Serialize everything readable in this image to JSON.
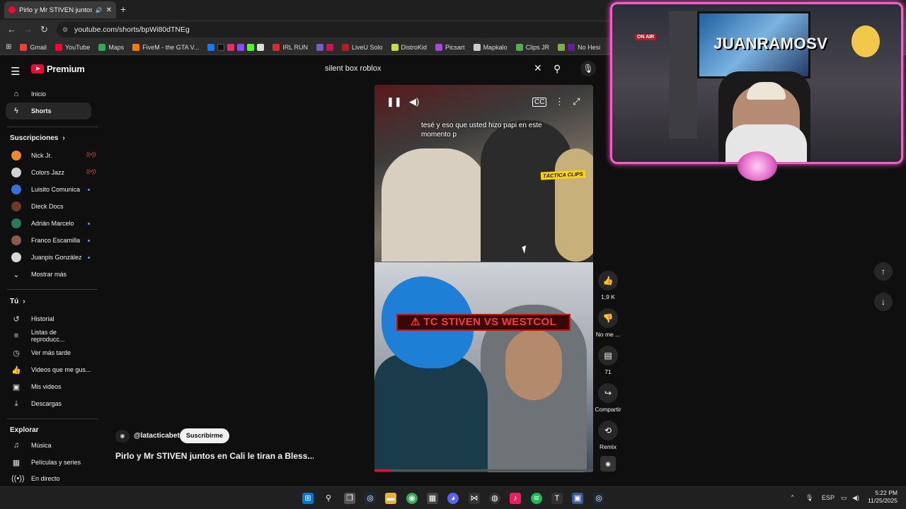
{
  "browser": {
    "tab_title": "Pirlo y Mr STIVEN juntos en",
    "new_tab": "+",
    "url": "youtube.com/shorts/bpWi80dTNEg",
    "bookmarks": [
      "Gmail",
      "YouTube",
      "Maps",
      "FiveM - the GTA V...",
      "IRL RUN",
      "LiveU Solo",
      "DistroKid",
      "Picsart",
      "Mapkalo",
      "Clips JR",
      "No Hesi"
    ]
  },
  "header": {
    "logo": "Premium",
    "search_value": "silent box roblox"
  },
  "sidebar": {
    "main": [
      {
        "label": "Inicio",
        "icon": "home-icon"
      },
      {
        "label": "Shorts",
        "icon": "shorts-icon"
      }
    ],
    "subs_heading": "Suscripciones",
    "subs": [
      {
        "label": "Nick Jr.",
        "status": "live",
        "color": "#f08a24"
      },
      {
        "label": "Colors Jazz",
        "status": "live",
        "color": "#d0d0d0"
      },
      {
        "label": "Luisito Comunica",
        "status": "new",
        "color": "#3a6fd8"
      },
      {
        "label": "Dieck Docs",
        "status": "",
        "color": "#6b3a2a"
      },
      {
        "label": "Adrián Marcelo",
        "status": "new",
        "color": "#2a7a5a"
      },
      {
        "label": "Franco Escamilla",
        "status": "new",
        "color": "#8a5a4a"
      },
      {
        "label": "Juanpis González",
        "status": "new",
        "color": "#d7d7d7"
      }
    ],
    "show_more": "Mostrar más",
    "you_heading": "Tú",
    "you": [
      {
        "label": "Historial",
        "icon": "history-icon"
      },
      {
        "label": "Listas de reproducc...",
        "icon": "playlists-icon"
      },
      {
        "label": "Ver más tarde",
        "icon": "watch-later-icon"
      },
      {
        "label": "Videos que me gus...",
        "icon": "liked-icon"
      },
      {
        "label": "Mis videos",
        "icon": "my-videos-icon"
      },
      {
        "label": "Descargas",
        "icon": "downloads-icon"
      }
    ],
    "explore_heading": "Explorar",
    "explore": [
      {
        "label": "Música",
        "icon": "music-icon"
      },
      {
        "label": "Películas y series",
        "icon": "movies-icon"
      },
      {
        "label": "En directo",
        "icon": "live-icon"
      }
    ]
  },
  "video": {
    "caption": "tesé y eso que usted hizo papi en este momento p",
    "watermark": "TÁCTICA CLIPS",
    "banner": "⚠ TC STIVEN VS WESTCOL",
    "progress": 0.07,
    "channel_handle": "@latacticabet",
    "subscribe": "Suscribirme",
    "title": "Pirlo y Mr STIVEN juntos en Cali le tiran a Bless..."
  },
  "actions": {
    "likes": "1,9 K",
    "dislike": "No me ...",
    "comments": "71",
    "share": "Compartir",
    "remix": "Remix"
  },
  "webcam": {
    "onair": "ON AIR",
    "tv_text": "JUANRAMOSV"
  },
  "taskbar": {
    "lang": "ESP",
    "time": "5:22 PM",
    "date": "11/25/2025"
  }
}
